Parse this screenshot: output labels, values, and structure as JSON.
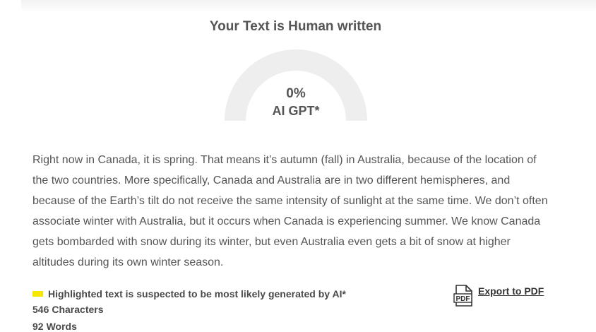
{
  "result": {
    "title": "Your Text is Human written",
    "percent": "0%",
    "percent_value": 0,
    "label": "AI GPT*"
  },
  "analyzed_text": "Right now in Canada, it is spring. That means it’s autumn (fall) in Australia, because of the location of the two countries. More specifically, Canada and Australia are in two different hemispheres, and because of the Earth’s tilt do not receive the same intensity of sunlight at the same time. We don’t often associate winter with Australia, but it occurs when Canada is experiencing summer. We know Canada gets bombarded with snow during its winter, but even Australia even gets a bit of snow at higher altitudes during its own winter season.",
  "legend": {
    "highlight_note": "Highlighted text is suspected to be most likely generated by AI*",
    "highlight_color": "#f7e600"
  },
  "stats": {
    "characters_count": "546",
    "characters_label": "Characters",
    "words_count": "92",
    "words_label": "Words"
  },
  "export": {
    "label": "Export to PDF",
    "icon": "pdf-file-icon",
    "icon_text": "PDF"
  },
  "colors": {
    "gauge_track": "#eeeeee",
    "gauge_fill": "#e05a4f"
  }
}
